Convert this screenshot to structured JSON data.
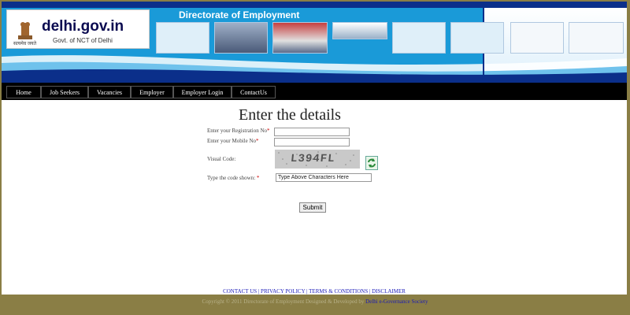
{
  "header": {
    "site_title": "delhi.gov.in",
    "site_subtitle": "Govt. of NCT of Delhi",
    "emblem_motto": "सत्यमेव जयते",
    "directorate_title": "Directorate of Employment"
  },
  "nav": {
    "items": [
      {
        "label": "Home"
      },
      {
        "label": "Job Seekers"
      },
      {
        "label": "Vacancies"
      },
      {
        "label": "Employer"
      },
      {
        "label": "Employer Login"
      },
      {
        "label": "ContactUs"
      }
    ]
  },
  "form": {
    "heading": "Enter the details",
    "registration_label": "Enter your Registration No",
    "mobile_label": "Enter your Mobile No",
    "visual_code_label": "Visual Code:",
    "type_code_label": "Type the code shown:",
    "required_mark": "*",
    "captcha_text": "L394FL",
    "registration_value": "",
    "mobile_value": "",
    "code_value": "Type Above Characters Here",
    "submit_label": "Submit"
  },
  "footer": {
    "links": "CONTACT US | PRIVACY POLICY | TERMS & CONDITIONS | DISCLAIMER",
    "copyright": "Copyright © 2011 Directorate of Employment   Designed & Developed by ",
    "developer": "Delhi e-Governance Society"
  }
}
